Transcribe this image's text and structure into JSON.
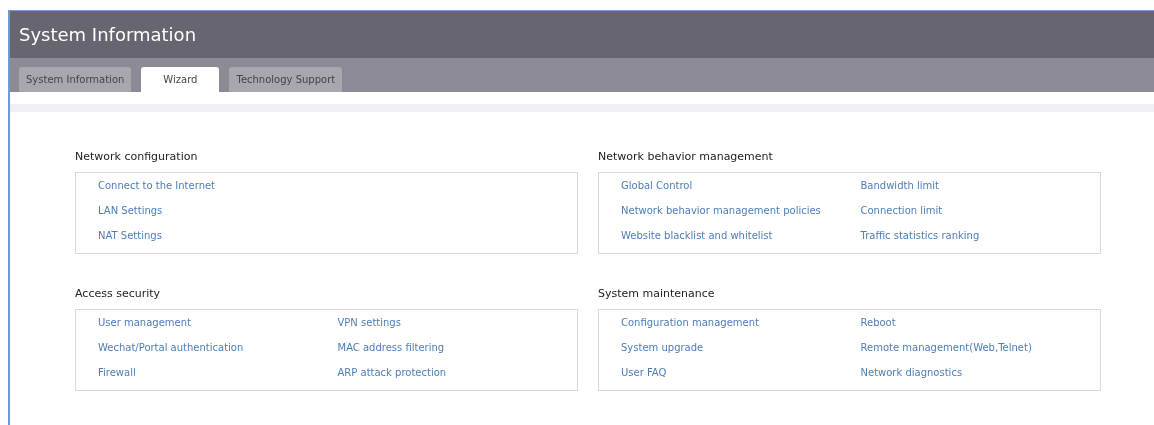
{
  "window": {
    "title": "System Information"
  },
  "tabs": [
    {
      "label": "System Information",
      "selected": false
    },
    {
      "label": "Wizard",
      "selected": true
    },
    {
      "label": "Technology Support",
      "selected": false
    }
  ],
  "sections": [
    {
      "title": "Network configuration",
      "columns": [
        [
          "Connect to the Internet",
          "LAN Settings",
          "NAT Settings"
        ]
      ]
    },
    {
      "title": "Network behavior management",
      "columns": [
        [
          "Global Control",
          "Network behavior management policies",
          "Website blacklist and whitelist"
        ],
        [
          "Bandwidth limit",
          "Connection limit",
          "Traffic statistics ranking"
        ]
      ]
    },
    {
      "title": "Access security",
      "columns": [
        [
          "User management",
          "Wechat/Portal authentication",
          "Firewall"
        ],
        [
          "VPN settings",
          "MAC address filtering",
          "ARP attack protection"
        ]
      ]
    },
    {
      "title": "System maintenance",
      "columns": [
        [
          "Configuration management",
          "System upgrade",
          "User FAQ"
        ],
        [
          "Reboot",
          "Remote management(Web,Telnet)",
          "Network diagnostics"
        ]
      ]
    }
  ]
}
